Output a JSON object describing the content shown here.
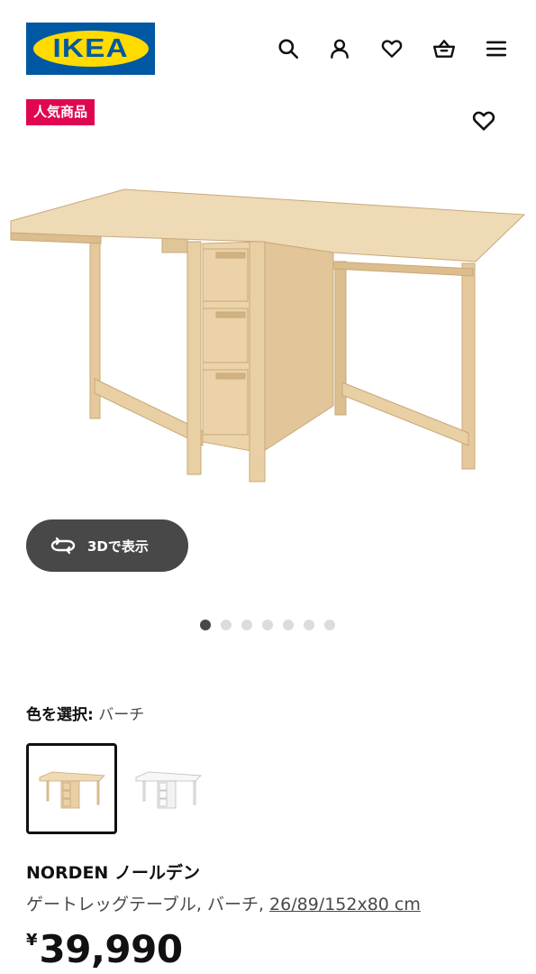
{
  "header": {
    "logo_text": "IKEA",
    "icons": [
      "search-icon",
      "user-icon",
      "heart-icon",
      "basket-icon",
      "menu-icon"
    ]
  },
  "badge": {
    "label": "人気商品",
    "color": "#e00751"
  },
  "gallery": {
    "view_3d_label": "3Dで表示",
    "dots_total": 7,
    "dots_active_index": 0
  },
  "color_select": {
    "label": "色を選択:",
    "value": "バーチ",
    "options": [
      "バーチ",
      "ホワイト"
    ]
  },
  "product": {
    "name": "NORDEN ノールデン",
    "description": "ゲートレッグテーブル, バーチ, ",
    "dimensions_link": "26/89/152x80 cm",
    "currency": "¥",
    "price": "39,990"
  },
  "colors": {
    "ikea_blue": "#0058a3",
    "ikea_yellow": "#ffdb00",
    "badge_red": "#e00751",
    "dark_button": "#484848",
    "wood": "#e8cfa4"
  }
}
